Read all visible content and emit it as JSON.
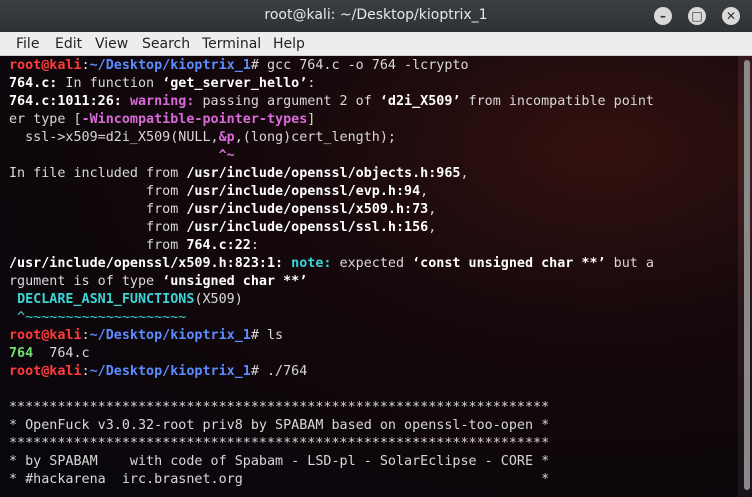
{
  "window": {
    "title": "root@kali: ~/Desktop/kioptrix_1",
    "min": "–",
    "max": "□",
    "close": "✕"
  },
  "menu": [
    "File",
    "Edit",
    "View",
    "Search",
    "Terminal",
    "Help"
  ],
  "terminal": [
    [
      [
        "root@kali",
        "r"
      ],
      [
        ":",
        "t"
      ],
      [
        "~/Desktop/kioptrix_1",
        "b"
      ],
      [
        "# gcc 764.c -o 764 -lcrypto",
        "t"
      ]
    ],
    [
      [
        "764.c:",
        "w"
      ],
      [
        " In function ",
        "t"
      ],
      [
        "‘get_server_hello’",
        "w"
      ],
      [
        ":",
        "t"
      ]
    ],
    [
      [
        "764.c:1011:26:",
        "w"
      ],
      [
        " ",
        "t"
      ],
      [
        "warning:",
        "m"
      ],
      [
        " passing argument 2 of ",
        "t"
      ],
      [
        "‘d2i_X509’",
        "w"
      ],
      [
        " from incompatible point",
        "t"
      ]
    ],
    [
      [
        "er type [",
        "t"
      ],
      [
        "-Wincompatible-pointer-types",
        "m"
      ],
      [
        "]",
        "t"
      ]
    ],
    [
      [
        "  ssl->x509=d2i_X509(NULL,",
        "t"
      ],
      [
        "&p",
        "m"
      ],
      [
        ",(long)cert_length);",
        "t"
      ]
    ],
    [
      [
        "                          ^~",
        "m"
      ]
    ],
    [
      [
        "In file included from ",
        "t"
      ],
      [
        "/usr/include/openssl/objects.h:965",
        "w"
      ],
      [
        ",",
        "t"
      ]
    ],
    [
      [
        "                 from ",
        "t"
      ],
      [
        "/usr/include/openssl/evp.h:94",
        "w"
      ],
      [
        ",",
        "t"
      ]
    ],
    [
      [
        "                 from ",
        "t"
      ],
      [
        "/usr/include/openssl/x509.h:73",
        "w"
      ],
      [
        ",",
        "t"
      ]
    ],
    [
      [
        "                 from ",
        "t"
      ],
      [
        "/usr/include/openssl/ssl.h:156",
        "w"
      ],
      [
        ",",
        "t"
      ]
    ],
    [
      [
        "                 from ",
        "t"
      ],
      [
        "764.c:22",
        "w"
      ],
      [
        ":",
        "t"
      ]
    ],
    [
      [
        "/usr/include/openssl/x509.h:823:1:",
        "w"
      ],
      [
        " ",
        "t"
      ],
      [
        "note:",
        "c"
      ],
      [
        " expected ",
        "t"
      ],
      [
        "‘const unsigned char **’",
        "w"
      ],
      [
        " but a",
        "t"
      ]
    ],
    [
      [
        "rgument is of type ",
        "t"
      ],
      [
        "‘unsigned char **’",
        "w"
      ]
    ],
    [
      [
        " ",
        "t"
      ],
      [
        "DECLARE_ASN1_FUNCTIONS",
        "c"
      ],
      [
        "(X509)",
        "t"
      ]
    ],
    [
      [
        " ^~~~~~~~~~~~~~~~~~~~~",
        "cy"
      ]
    ],
    [
      [
        "root@kali",
        "r"
      ],
      [
        ":",
        "t"
      ],
      [
        "~/Desktop/kioptrix_1",
        "b"
      ],
      [
        "# ls",
        "t"
      ]
    ],
    [
      [
        "764",
        "g"
      ],
      [
        "  764.c",
        "t"
      ]
    ],
    [
      [
        "root@kali",
        "r"
      ],
      [
        ":",
        "t"
      ],
      [
        "~/Desktop/kioptrix_1",
        "b"
      ],
      [
        "# ./764",
        "t"
      ]
    ],
    [
      [
        "",
        "t"
      ]
    ],
    [
      [
        "*******************************************************************",
        "t"
      ]
    ],
    [
      [
        "* OpenFuck v3.0.32-root priv8 by SPABAM based on openssl-too-open *",
        "t"
      ]
    ],
    [
      [
        "*******************************************************************",
        "t"
      ]
    ],
    [
      [
        "* by SPABAM    with code of Spabam - LSD-pl - SolarEclipse - CORE *",
        "t"
      ]
    ],
    [
      [
        "* #hackarena  irc.brasnet.org                                     *",
        "t"
      ]
    ]
  ]
}
